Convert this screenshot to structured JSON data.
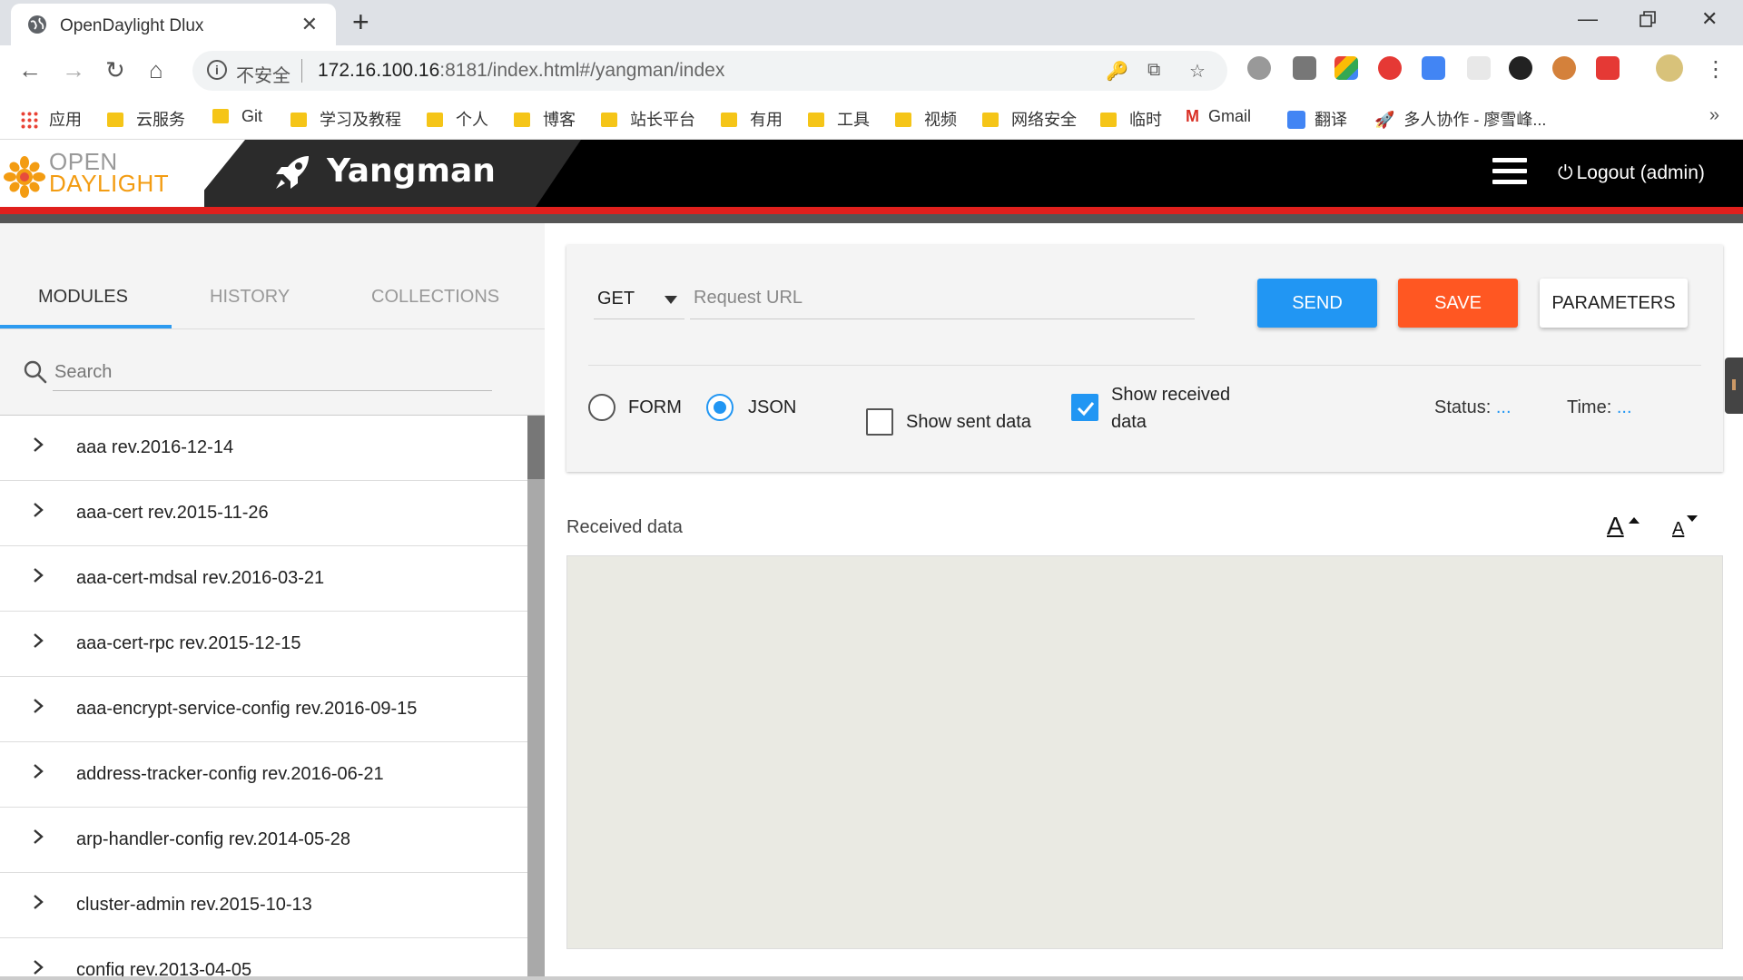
{
  "browser": {
    "tab_title": "OpenDaylight Dlux",
    "tab_close": "✕",
    "new_tab": "+",
    "omnibox": {
      "security_label": "不安全",
      "url_host": "172.16.100.16",
      "url_rest": ":8181/index.html#/yangman/index"
    },
    "bookmarks": [
      {
        "label": "应用",
        "type": "apps"
      },
      {
        "label": "云服务",
        "type": "folder"
      },
      {
        "label": "Git",
        "type": "folder"
      },
      {
        "label": "学习及教程",
        "type": "folder"
      },
      {
        "label": "个人",
        "type": "folder"
      },
      {
        "label": "博客",
        "type": "folder"
      },
      {
        "label": "站长平台",
        "type": "folder"
      },
      {
        "label": "有用",
        "type": "folder"
      },
      {
        "label": "工具",
        "type": "folder"
      },
      {
        "label": "视频",
        "type": "folder"
      },
      {
        "label": "网络安全",
        "type": "folder"
      },
      {
        "label": "临时",
        "type": "folder"
      },
      {
        "label": "Gmail",
        "type": "gmail"
      },
      {
        "label": "翻译",
        "type": "translate"
      },
      {
        "label": "多人协作 - 廖雪峰...",
        "type": "rocket"
      }
    ],
    "bookmarks_more": "»"
  },
  "app": {
    "logo_line1": "OPEN",
    "logo_line2": "DAYLIGHT",
    "title": "Yangman",
    "logout_label": "Logout (admin)",
    "colors": {
      "accent_red": "#e0201d",
      "primary_blue": "#2196f3",
      "save_orange": "#ff5722"
    }
  },
  "left_panel": {
    "tabs": [
      "MODULES",
      "HISTORY",
      "COLLECTIONS"
    ],
    "active_tab": "MODULES",
    "search_placeholder": "Search",
    "modules": [
      "aaa rev.2016-12-14",
      "aaa-cert rev.2015-11-26",
      "aaa-cert-mdsal rev.2016-03-21",
      "aaa-cert-rpc rev.2015-12-15",
      "aaa-encrypt-service-config rev.2016-09-15",
      "address-tracker-config rev.2016-06-21",
      "arp-handler-config rev.2014-05-28",
      "cluster-admin rev.2015-10-13",
      "config rev.2013-04-05"
    ]
  },
  "request": {
    "method": "GET",
    "url_placeholder": "Request URL",
    "send_label": "SEND",
    "save_label": "SAVE",
    "params_label": "PARAMETERS",
    "mode_form": "FORM",
    "mode_json": "JSON",
    "selected_mode": "JSON",
    "show_sent_label": "Show sent data",
    "show_sent_checked": false,
    "show_received_line1": "Show received",
    "show_received_line2": "data",
    "show_received_checked": true,
    "status_label": "Status:",
    "status_value": "...",
    "time_label": "Time:",
    "time_value": "..."
  },
  "received": {
    "label": "Received data",
    "font_increase": "A",
    "font_decrease": "A"
  }
}
